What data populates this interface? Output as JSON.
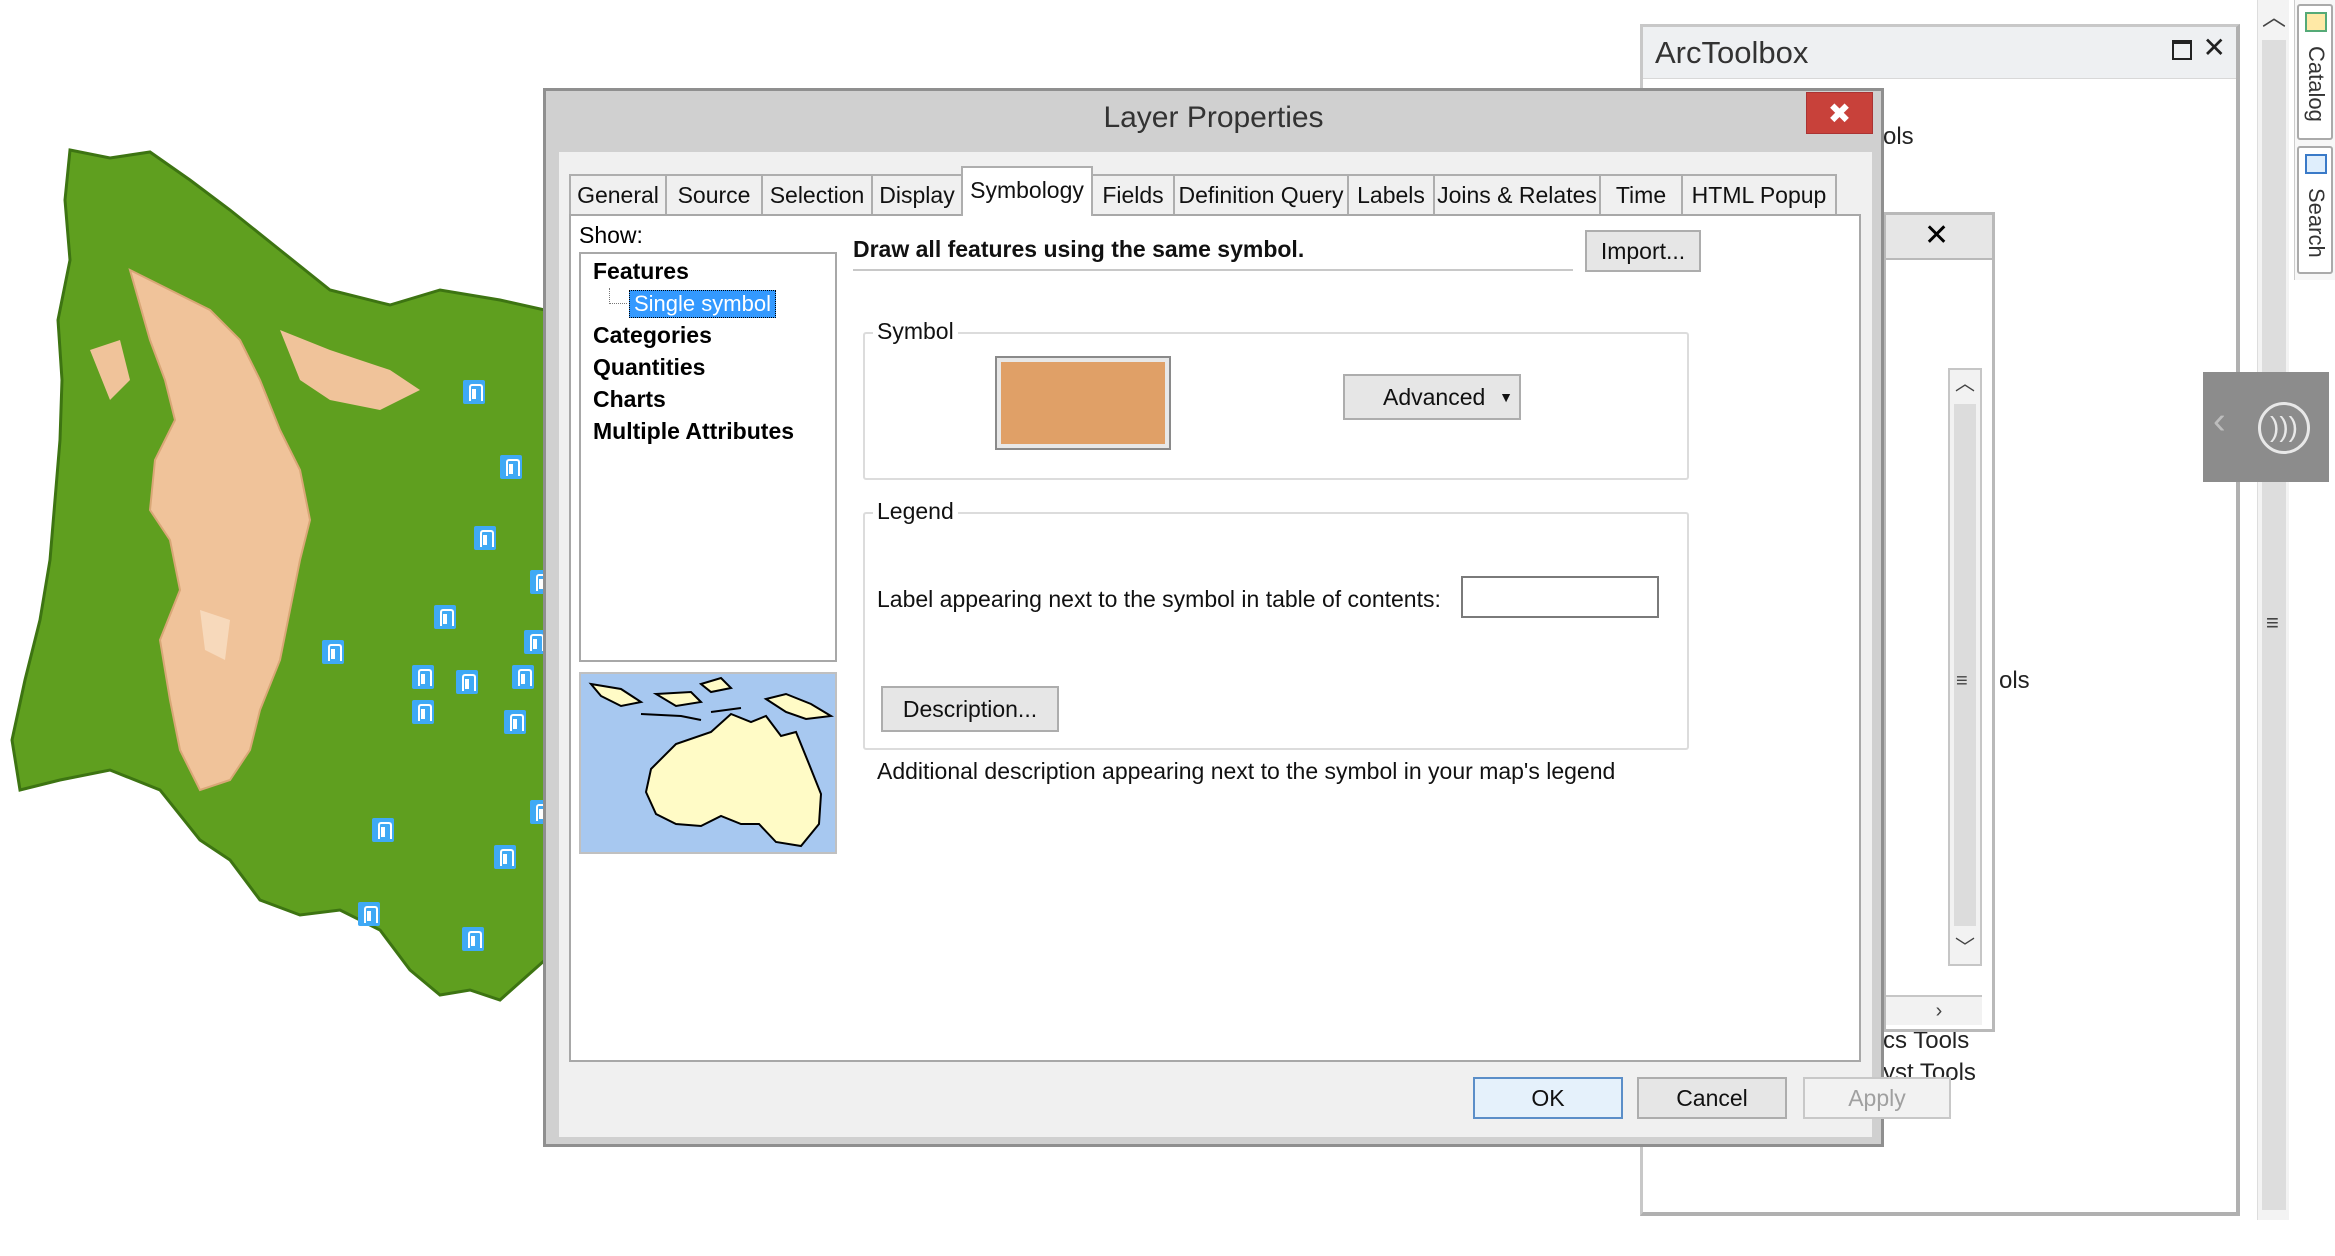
{
  "layer_properties": {
    "title": "Layer Properties",
    "close": "✖",
    "tabs": [
      {
        "label": "General"
      },
      {
        "label": "Source"
      },
      {
        "label": "Selection"
      },
      {
        "label": "Display"
      },
      {
        "label": "Symbology"
      },
      {
        "label": "Fields"
      },
      {
        "label": "Definition Query"
      },
      {
        "label": "Labels"
      },
      {
        "label": "Joins & Relates"
      },
      {
        "label": "Time"
      },
      {
        "label": "HTML Popup"
      }
    ],
    "active_tab": "Symbology",
    "show": {
      "label": "Show:",
      "items": [
        "Features",
        "Categories",
        "Quantities",
        "Charts",
        "Multiple Attributes"
      ],
      "selected_child": "Single symbol"
    },
    "description_text": "Draw all features using the same symbol.",
    "import_button": "Import...",
    "symbol_group": {
      "title": "Symbol",
      "swatch_color": "#e0a067",
      "advanced_button": "Advanced"
    },
    "legend_group": {
      "title": "Legend",
      "label_text": "Label appearing next to the symbol in table of contents:",
      "label_value": "",
      "description_button": "Description...",
      "description_note": "Additional description appearing next to the symbol in your map's legend"
    },
    "buttons": {
      "ok": "OK",
      "cancel": "Cancel",
      "apply": "Apply"
    }
  },
  "arctoolbox": {
    "title": "ArcToolbox",
    "max_icon": "maximize-icon",
    "close": "✕",
    "partial_texts": [
      "ols",
      "ols",
      "cs Tools",
      "yst Tools"
    ],
    "inner_close": "✕"
  },
  "side_tabs": [
    {
      "label": "Catalog",
      "icon": "catalog-icon"
    },
    {
      "label": "Search",
      "icon": "search-icon"
    }
  ],
  "colors": {
    "map_green": "#5f9f1f",
    "map_tan": "#f0c39a",
    "gauge_blue": "#3fa9f5",
    "close_red": "#c8413a"
  }
}
